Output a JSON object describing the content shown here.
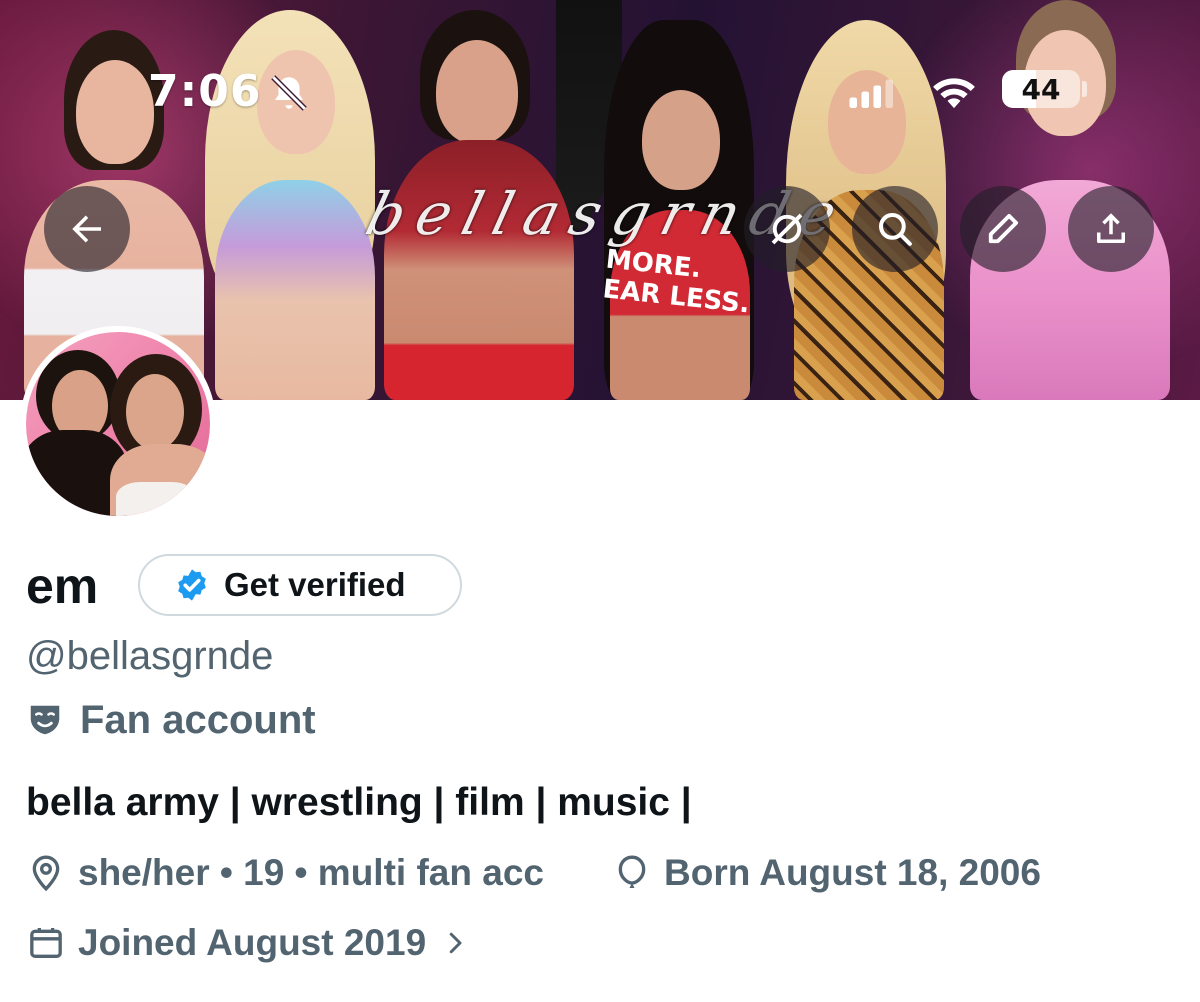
{
  "status_bar": {
    "time": "7:06",
    "battery": "44",
    "battery_level_percent": 44,
    "icons": [
      "bell-slash-icon",
      "cellular-signal-icon",
      "wifi-icon",
      "battery-icon"
    ]
  },
  "banner": {
    "watermark": "bellasgrnde",
    "shirt_text": "MORE.\nEAR LESS.",
    "colors": {
      "background": "#3a1634",
      "accent": "#6a1a3d"
    }
  },
  "header_buttons": [
    {
      "icon": "back-arrow-icon"
    },
    {
      "icon": "grok-icon"
    },
    {
      "icon": "search-icon"
    },
    {
      "icon": "pencil-icon"
    },
    {
      "icon": "share-icon"
    }
  ],
  "profile": {
    "name": "em",
    "verify_label": "Get verified",
    "handle": "@bellasgrnde",
    "category": "Fan account",
    "bio": "bella army | wrestling | film | music |",
    "location": "she/her • 19 • multi fan acc",
    "birthday": "Born August 18, 2006",
    "joined": "Joined August 2019"
  },
  "colors": {
    "primary_text": "#0f1419",
    "secondary_text": "#536471",
    "verified_blue": "#1d9bf0",
    "border": "#cfd9de"
  }
}
